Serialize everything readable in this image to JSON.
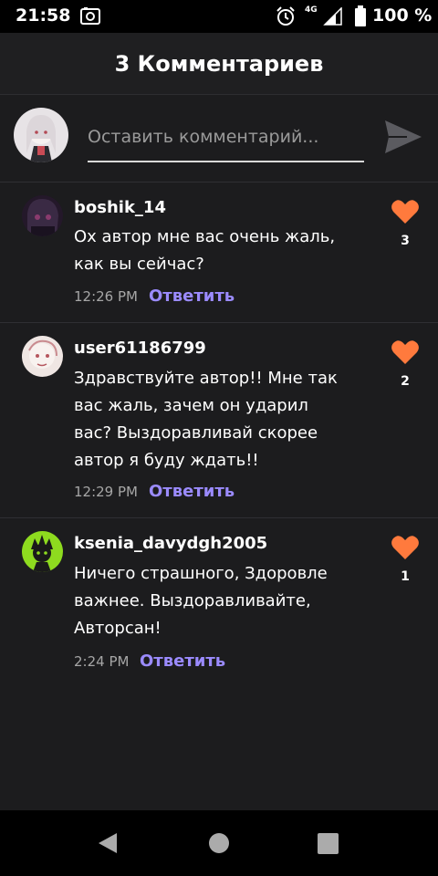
{
  "status_bar": {
    "time": "21:58",
    "network": "4G",
    "battery": "100 %"
  },
  "header": {
    "title": "3 Комментариев"
  },
  "composer": {
    "placeholder": "Оставить комментарий..."
  },
  "comments": [
    {
      "username": "boshik_14",
      "text": "Ох автор мне вас очень жаль, как вы сейчас?",
      "time": "12:26 PM",
      "reply_label": "Ответить",
      "likes": "3"
    },
    {
      "username": "user61186799",
      "text": "Здравствуйте автор!! Мне так вас жаль, зачем он ударил вас? Выздоравливай скорее автор я буду ждать!!",
      "time": "12:29 PM",
      "reply_label": "Ответить",
      "likes": "2"
    },
    {
      "username": "ksenia_davydgh2005",
      "text": "Ничего страшного, Здоровле важнее. Выздоравливайте, Авторсан!",
      "time": "2:24 PM",
      "reply_label": "Ответить",
      "likes": "1"
    }
  ],
  "colors": {
    "accent": "#9b8bff",
    "heart": "#ff7a3d",
    "background": "#1c1c1e"
  },
  "icons": {
    "send": "send-icon",
    "like": "heart-icon",
    "back": "back-triangle-icon",
    "home": "home-circle-icon",
    "recents": "recents-square-icon"
  }
}
